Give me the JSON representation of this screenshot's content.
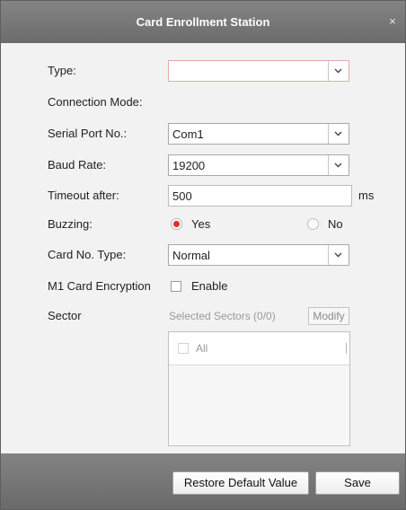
{
  "window": {
    "title": "Card Enrollment Station",
    "close_glyph": "×"
  },
  "form": {
    "type": {
      "label": "Type:",
      "value": ""
    },
    "connection_mode": {
      "label": "Connection Mode:"
    },
    "serial_port": {
      "label": "Serial Port No.:",
      "value": "Com1"
    },
    "baud_rate": {
      "label": "Baud Rate:",
      "value": "19200"
    },
    "timeout": {
      "label": "Timeout after:",
      "value": "500",
      "unit": "ms"
    },
    "buzzing": {
      "label": "Buzzing:",
      "options": [
        {
          "label": "Yes",
          "selected": true
        },
        {
          "label": "No",
          "selected": false
        }
      ]
    },
    "card_no_type": {
      "label": "Card No. Type:",
      "value": "Normal"
    },
    "m1_encryption": {
      "label": "M1 Card Encryption",
      "checkbox_label": "Enable",
      "checked": false
    },
    "sector": {
      "label": "Sector",
      "selected_text": "Selected Sectors (0/0)",
      "modify_label": "Modify",
      "list_header": "All"
    }
  },
  "footer": {
    "restore_label": "Restore Default Value",
    "save_label": "Save"
  },
  "colors": {
    "titlebar": "#777777",
    "radio_selected": "#e0322d",
    "invalid_border": "#e6a7a7"
  },
  "icons": [
    "close-icon",
    "chevron-down-icon",
    "radio-checked-icon",
    "radio-unchecked-icon",
    "checkbox-icon"
  ]
}
